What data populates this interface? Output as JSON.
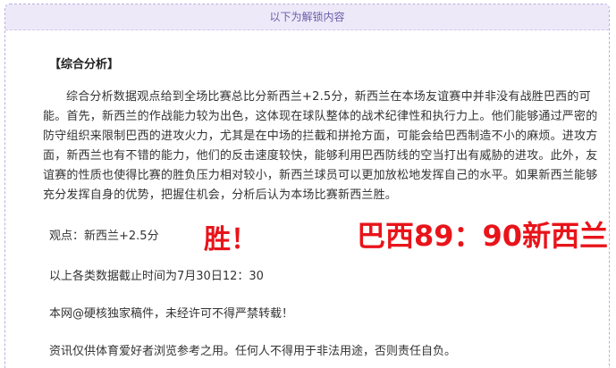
{
  "unlock_banner": "以下为解锁内容",
  "section_title": "【综合分析】",
  "analysis_text": "综合分析数据观点给到全场比赛总比分新西兰+2.5分，新西兰在本场友谊赛中并非没有战胜巴西的可能。首先，新西兰的作战能力较为出色，这体现在球队整体的战术纪律性和执行力上。他们能够通过严密的防守组织来限制巴西的进攻火力，尤其是在中场的拦截和拼抢方面，可能会给巴西制造不小的麻烦。进攻方面，新西兰也有不错的能力，他们的反击速度较快，能够利用巴西防线的空当打出有威胁的进攻。此外，友谊赛的性质也使得比赛的胜负压力相对较小，新西兰球员可以更加放松地发挥自己的水平。如果新西兰能够充分发挥自身的优势，把握住机会，分析后认为本场比赛新西兰胜。",
  "opinion": "观点：新西兰+2.5分",
  "win_mark": "胜！",
  "score_mark": "巴西89：90新西兰",
  "data_cutoff": "以上各类数据截止时间为7月30日12：30",
  "copyright": "本网@硬核独家稿件，未经许可不得严禁转载！",
  "disclaimer": "资讯仅供体育爱好者浏览参考之用。任何人不得用于非法用途，否则责任自负。",
  "colors": {
    "accent_red": "#e8141a",
    "banner_bg": "#ede9f9",
    "banner_text": "#6a5fa8",
    "border": "#b9aedc"
  }
}
